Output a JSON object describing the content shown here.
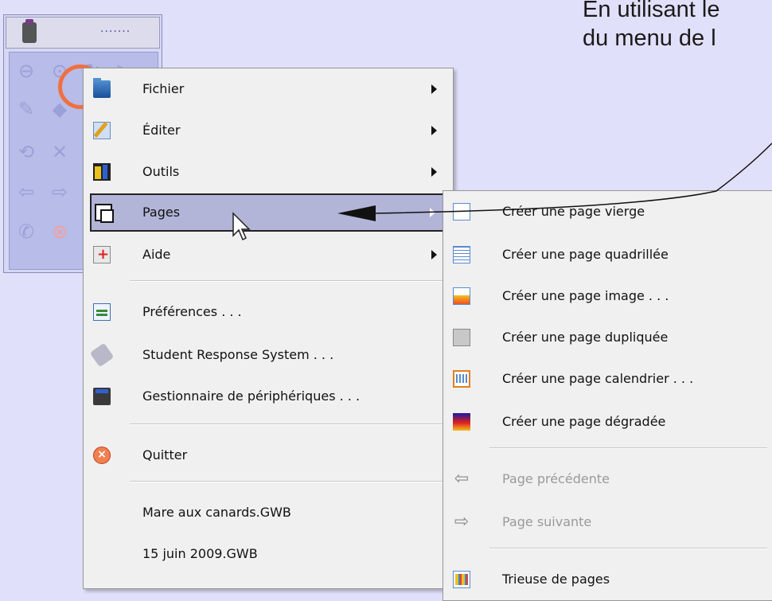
{
  "caption": {
    "line1": "En utilisant le",
    "line2": "du menu de l"
  },
  "toolbar": {
    "dots": "·······"
  },
  "main_menu": {
    "items": [
      {
        "label": "Fichier",
        "icon": "folder-icon",
        "submenu": true
      },
      {
        "label": "Éditer",
        "icon": "edit-icon",
        "submenu": true
      },
      {
        "label": "Outils",
        "icon": "tools-icon",
        "submenu": true
      },
      {
        "label": "Pages",
        "icon": "pages-icon",
        "submenu": true,
        "selected": true
      },
      {
        "label": "Aide",
        "icon": "help-icon",
        "submenu": true
      },
      {
        "label": "Préférences . . .",
        "icon": "preferences-icon"
      },
      {
        "label": "Student Response System . . .",
        "icon": "student-response-icon"
      },
      {
        "label": "Gestionnaire de périphériques . . .",
        "icon": "device-manager-icon"
      },
      {
        "label": "Quitter",
        "icon": "quit-icon"
      },
      {
        "label": "Mare aux canards.GWB"
      },
      {
        "label": "15 juin 2009.GWB"
      }
    ]
  },
  "sub_menu": {
    "items": [
      {
        "label": "Créer une page vierge",
        "icon": "blank-page-icon"
      },
      {
        "label": "Créer une page quadrillée",
        "icon": "grid-page-icon"
      },
      {
        "label": "Créer une page image . . .",
        "icon": "image-page-icon"
      },
      {
        "label": "Créer une page dupliquée",
        "icon": "duplicate-page-icon"
      },
      {
        "label": "Créer une page calendrier . . .",
        "icon": "calendar-page-icon"
      },
      {
        "label": "Créer une page dégradée",
        "icon": "gradient-page-icon"
      },
      {
        "label": "Page précédente",
        "icon": "arrow-left-icon",
        "disabled": true
      },
      {
        "label": "Page suivante",
        "icon": "arrow-right-icon",
        "disabled": true
      },
      {
        "label": "Trieuse de pages",
        "icon": "page-sorter-icon"
      }
    ]
  },
  "colors": {
    "background": "#e0e0fa",
    "highlight_ring": "#f07040",
    "selected_item": "#b2b4d8"
  }
}
